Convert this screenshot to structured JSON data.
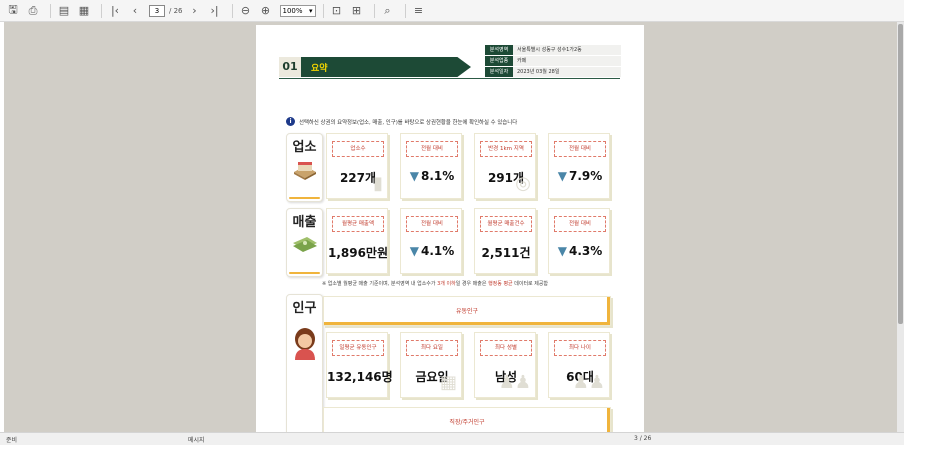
{
  "toolbar": {
    "page_current": "3",
    "page_total": "/ 26",
    "zoom": "100%"
  },
  "statusbar": {
    "left": "준비",
    "middle": "메시지",
    "right": "3 / 26"
  },
  "report": {
    "section_number": "01",
    "section_title": "요약",
    "info": [
      {
        "key": "분석영역",
        "value": "서울특별시 성동구 성수1가2동"
      },
      {
        "key": "분석업종",
        "value": "카페"
      },
      {
        "key": "분석일자",
        "value": "2023년 03월 28일"
      }
    ],
    "notice": "선택하신 상권의 요약정보(업소, 매출, 인구)를 바탕으로 상권현황을 한눈에 확인하실 수 있습니다",
    "stores": {
      "label": "업소",
      "cards": [
        {
          "label": "업소수",
          "value": "227개",
          "down": false
        },
        {
          "label": "전월 대비",
          "value": "8.1%",
          "down": true
        },
        {
          "label": "반경 1km 지역",
          "value": "291개",
          "down": false
        },
        {
          "label": "전월 대비",
          "value": "7.9%",
          "down": true
        }
      ]
    },
    "sales": {
      "label": "매출",
      "cards": [
        {
          "label": "월평균 매출액",
          "value": "1,896만원",
          "down": false
        },
        {
          "label": "전월 대비",
          "value": "4.1%",
          "down": true
        },
        {
          "label": "월평균 매출건수",
          "value": "2,511건",
          "down": false
        },
        {
          "label": "전월 대비",
          "value": "4.3%",
          "down": true
        }
      ]
    },
    "note": {
      "prefix": "※ 업소별 월평균 매출 기준이며, 분석영역 내 업소수가 ",
      "highlight1": "3개 이하",
      "middle": "일 경우 매출은 ",
      "highlight2": "행정동 평균",
      "suffix": " 데이터로 제공함"
    },
    "population": {
      "label": "인구",
      "floating_header": "유동인구",
      "cards": [
        {
          "label": "일평균 유동인구",
          "value": "132,146명"
        },
        {
          "label": "최다 요일",
          "value": "금요일"
        },
        {
          "label": "최다 성별",
          "value": "남성"
        },
        {
          "label": "최다 나이",
          "value": "60대"
        }
      ],
      "resident_header": "직장/주거인구"
    }
  },
  "colors": {
    "accent_green": "#1d4a36",
    "accent_yellow": "#f0b43c",
    "label_red": "#c0392b",
    "down_arrow": "#4a86a8"
  }
}
